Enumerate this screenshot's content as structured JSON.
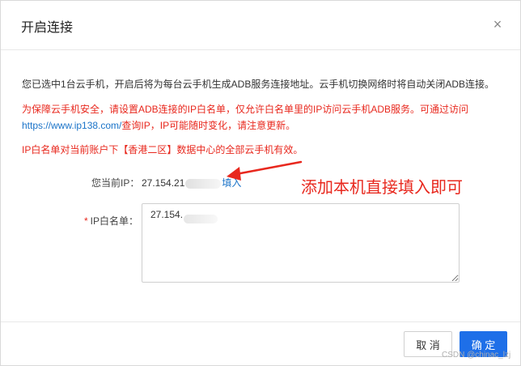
{
  "dialog": {
    "title": "开启连接",
    "close_icon": "close-icon",
    "close_glyph": "×"
  },
  "content": {
    "info_text": "您已选中1台云手机，开启后将为每台云手机生成ADB服务连接地址。云手机切换网络时将自动关闭ADB连接。",
    "warning_line1": "为保障云手机安全，请设置ADB连接的IP白名单，仅允许白名单里的IP访问云手机ADB服务。可通过访问",
    "warning_link": "https://www.ip138.com/",
    "warning_line2": "查询IP，IP可能随时变化，请注意更新。",
    "scope_text": "IP白名单对当前账户下【香港二区】数据中心的全部云手机有效。"
  },
  "form": {
    "current_ip_label": "您当前IP：",
    "current_ip_prefix": "27.154.21",
    "fill_link": "填入",
    "whitelist_required_mark": "*",
    "whitelist_label": "IP白名单：",
    "whitelist_value": "27.154."
  },
  "annotation": {
    "text": "添加本机直接填入即可",
    "color": "#e8281e"
  },
  "footer": {
    "cancel_label": "取 消",
    "ok_label": "确 定"
  },
  "watermark": "CSDN @chinac_lzj",
  "colors": {
    "primary": "#1e6fe8",
    "warning": "#e8281e",
    "link": "#1a73c8"
  }
}
